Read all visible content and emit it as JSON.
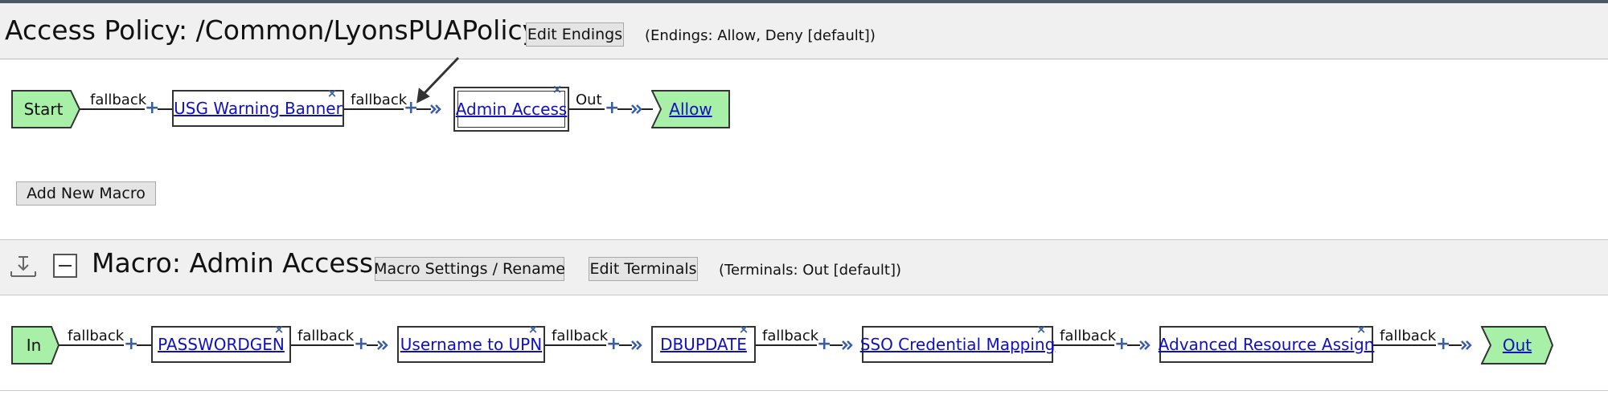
{
  "policy": {
    "title": "Access Policy: /Common/LyonsPUAPolicy",
    "edit_endings_label": "Edit Endings",
    "endings_note": "(Endings: Allow, Deny [default])",
    "start_label": "Start",
    "conn1": "fallback",
    "node1": "USG Warning Banner",
    "conn2": "fallback",
    "node2": "Admin Access",
    "conn3": "Out",
    "end_label": "Allow",
    "add_macro_label": "Add New Macro"
  },
  "macro": {
    "title": "Macro: Admin Access",
    "settings_label": "Macro Settings / Rename",
    "edit_terminals_label": "Edit Terminals",
    "terminals_note": "(Terminals: Out [default])",
    "in_label": "In",
    "conn1": "fallback",
    "node1": "PASSWORDGEN",
    "conn2": "fallback",
    "node2": "Username to UPN",
    "conn3": "fallback",
    "node3": "DBUPDATE",
    "conn4": "fallback",
    "node4": "SSO Credential Mapping",
    "conn5": "fallback",
    "node5": "Advanced Resource Assign",
    "conn6": "fallback",
    "out_label": "Out"
  },
  "icons": {
    "delete": "close-icon",
    "add": "plus-icon",
    "chevron": "double-chevron-right-icon",
    "expand": "expand-macro-icon",
    "collapse": "collapse-icon"
  },
  "colors": {
    "terminal_fill": "#a8f0a8",
    "link": "#1010c0",
    "accent": "#3a5fa0"
  }
}
